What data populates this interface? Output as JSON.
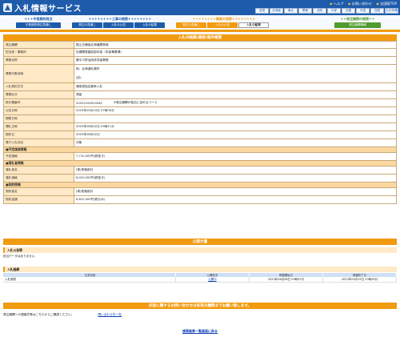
{
  "header": {
    "app_title": "入札情報サービス",
    "links": [
      "ヘルプ",
      "お問い合わせ",
      "全国版TOP"
    ],
    "regions": [
      "全国",
      "北海道",
      "東北",
      "関東",
      "北陸",
      "中部",
      "近畿",
      "中国",
      "四国",
      "九州沖縄"
    ]
  },
  "nav": {
    "groups": [
      {
        "title": "中長期的発注",
        "color": "#1e5cab",
        "tabs": [
          {
            "label": "中長期的発注見通し",
            "active": false
          }
        ]
      },
      {
        "title": "工事の検索",
        "color": "#1e5cab",
        "tabs": [
          {
            "label": "発注の見通し",
            "active": false
          },
          {
            "label": "入札の公告",
            "active": false
          },
          {
            "label": "入札の結果",
            "active": false
          }
        ]
      },
      {
        "title": "業務の検索",
        "color": "#f29a10",
        "tabs": [
          {
            "label": "発注の見通し",
            "active": false
          },
          {
            "label": "入札の公告",
            "active": false
          },
          {
            "label": "入札の結果",
            "active": true
          }
        ]
      },
      {
        "title": "発注機関の検索",
        "color": "#4f9c2f",
        "tabs": [
          {
            "label": "発注機関情報",
            "active": false
          }
        ]
      }
    ]
  },
  "detail": {
    "title": "入札の経緯(業務)案件概要",
    "rows": {
      "agency_label": "発注機関",
      "agency": "国土交通省北海道開発局",
      "office_label": "担当部・事務所",
      "office": "札幌開発建設部本部（本部事業課）",
      "project_label": "業務名称",
      "project": "豊平川栄治段床流量業務",
      "location_label": "業務対象地域",
      "location_1": "他：北海道札幌市",
      "location_2": "(記)",
      "method_label": "入札契約方式",
      "method": "通常型指名競争入札",
      "category_label": "業務区分",
      "category": "測量",
      "code_label": "設計書番号",
      "code": "2023210002026​2",
      "code_note": "※発注機関が独自に定めるコード",
      "notice_date_label": "公告日時",
      "notice_date": "2023年05月10日 07時30分",
      "deadline_label": "期限日時",
      "deadline": "",
      "open_date_label": "開札日時",
      "open_date": "2023年06月02日 09時11分",
      "contract_date_label": "契約日",
      "contract_date": "2023年06月02日",
      "electronic_label": "電子入札対応",
      "electronic": "対象"
    },
    "sections": {
      "budget": "■予定価格情報",
      "winner": "■落札者情報",
      "contract": "■契約情報"
    },
    "budget_label": "予定価格",
    "budget": "7,710,000円(税抜き)",
    "winner_name_label": "落札者名",
    "winner_name": "(株)拓殖設計",
    "winner_price_label": "落札価格",
    "winner_price": "6,020,000円(税抜き)",
    "contractor_label": "契約者名",
    "contractor": "(株)拓殖設計",
    "contract_price_label": "契約金額",
    "contract_price": "6,622,000円(税込み)"
  },
  "public_docs": {
    "title": "公開文書",
    "notice_head": "入札公告等",
    "notice_none": "該当データはありません",
    "history_head": "入札経緯",
    "columns": [
      "文書名称",
      "公開状況",
      "掲載開始日",
      "掲載終了日"
    ],
    "rows": [
      {
        "name": "入札調書",
        "status": "公開中",
        "start": "2023年06月06日 09時51分",
        "end": "2023年09月15日 23時00分"
      }
    ]
  },
  "contact": {
    "title": "内容に関するお問い合わせは各発注機関までお願い致します。",
    "text": "発注機関への連絡先等はこちらからご確認ください。",
    "link": "問い合わせ先一覧"
  },
  "footer": {
    "back_link": "検索結果一覧画面に戻る"
  }
}
